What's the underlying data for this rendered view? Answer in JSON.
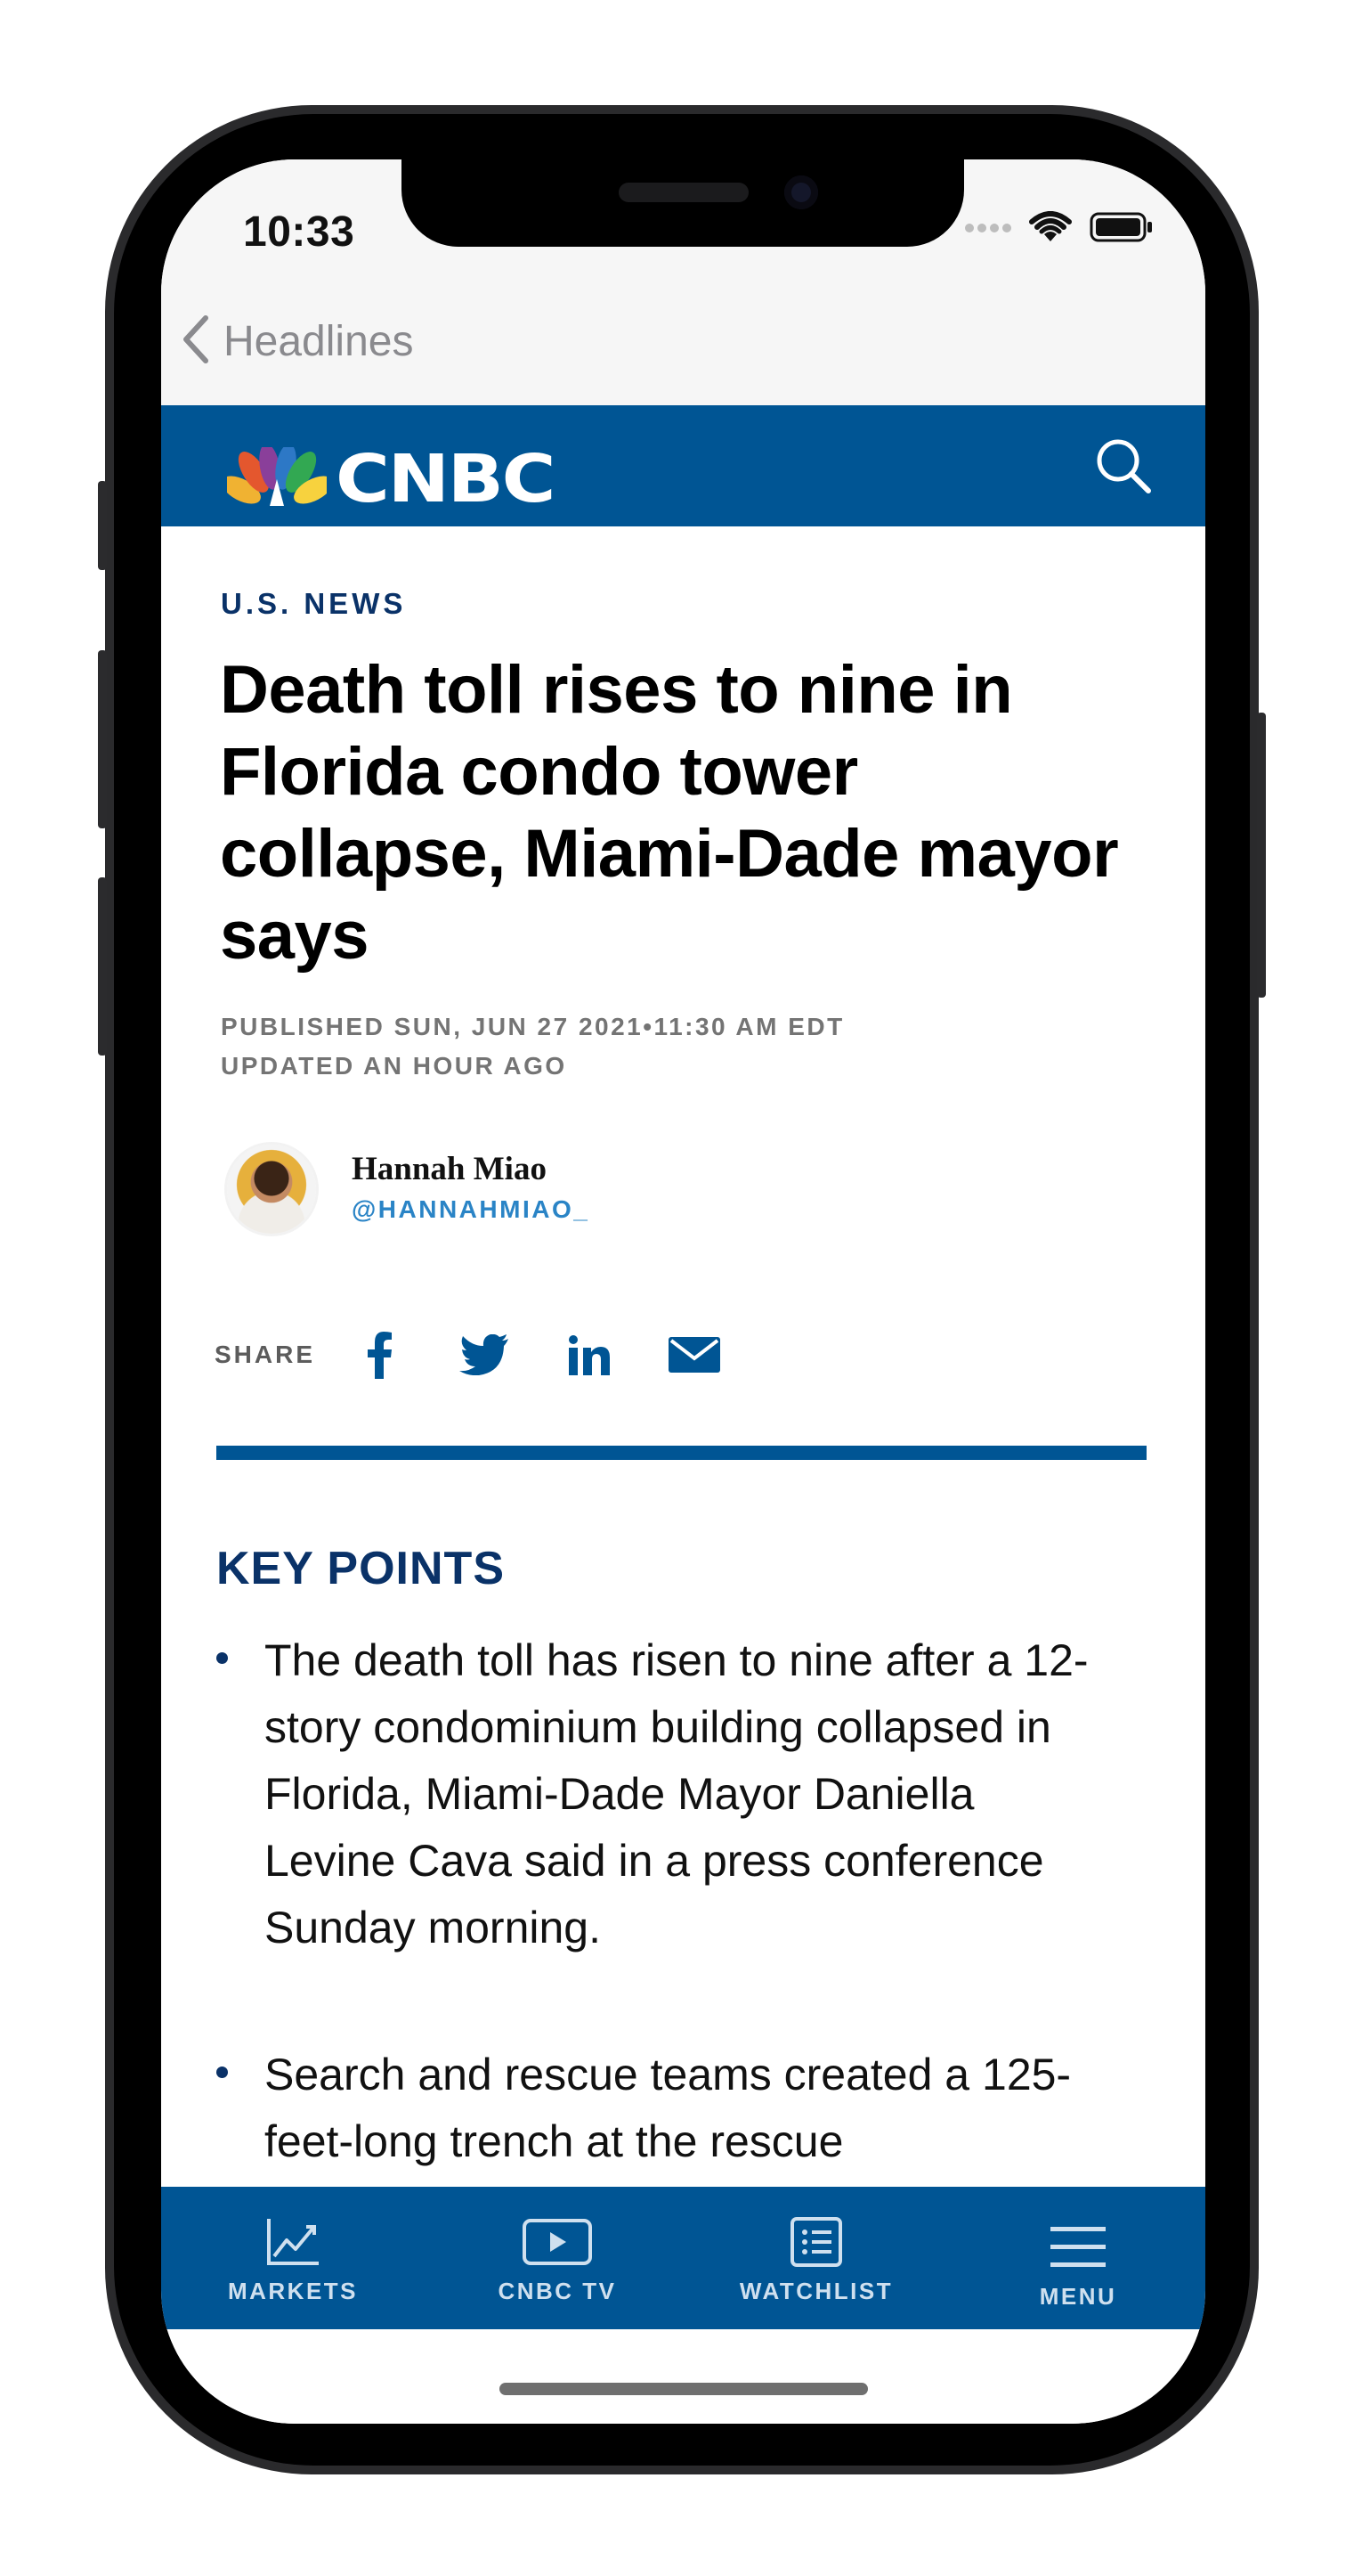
{
  "status_bar": {
    "time": "10:33"
  },
  "nav": {
    "back_label": "Headlines"
  },
  "brand": {
    "logo_text": "CNBC",
    "color": "#005594"
  },
  "article": {
    "section": "U.S. NEWS",
    "headline": "Death toll rises to nine in Florida condo tower collapse, Miami-Dade mayor says",
    "published": "PUBLISHED SUN, JUN 27 2021•11:30 AM EDT",
    "updated": "UPDATED AN HOUR AGO",
    "author": {
      "name": "Hannah Miao",
      "handle": "@HANNAHMIAO_"
    },
    "share": {
      "label": "SHARE",
      "icons": [
        "facebook-icon",
        "twitter-icon",
        "linkedin-icon",
        "email-icon"
      ]
    },
    "key_points_title": "KEY POINTS",
    "key_points": [
      "The death toll has risen to nine after a 12-story condominium building collapsed in Florida, Miami-Dade Mayor Daniella Levine Cava said in a press conference Sunday morning.",
      "Search and rescue teams created a 125-feet-long trench at the rescue"
    ]
  },
  "tabbar": {
    "items": [
      {
        "label": "MARKETS",
        "icon": "chart-icon"
      },
      {
        "label": "CNBC TV",
        "icon": "play-icon"
      },
      {
        "label": "WATCHLIST",
        "icon": "list-icon"
      },
      {
        "label": "MENU",
        "icon": "hamburger-icon"
      }
    ]
  }
}
